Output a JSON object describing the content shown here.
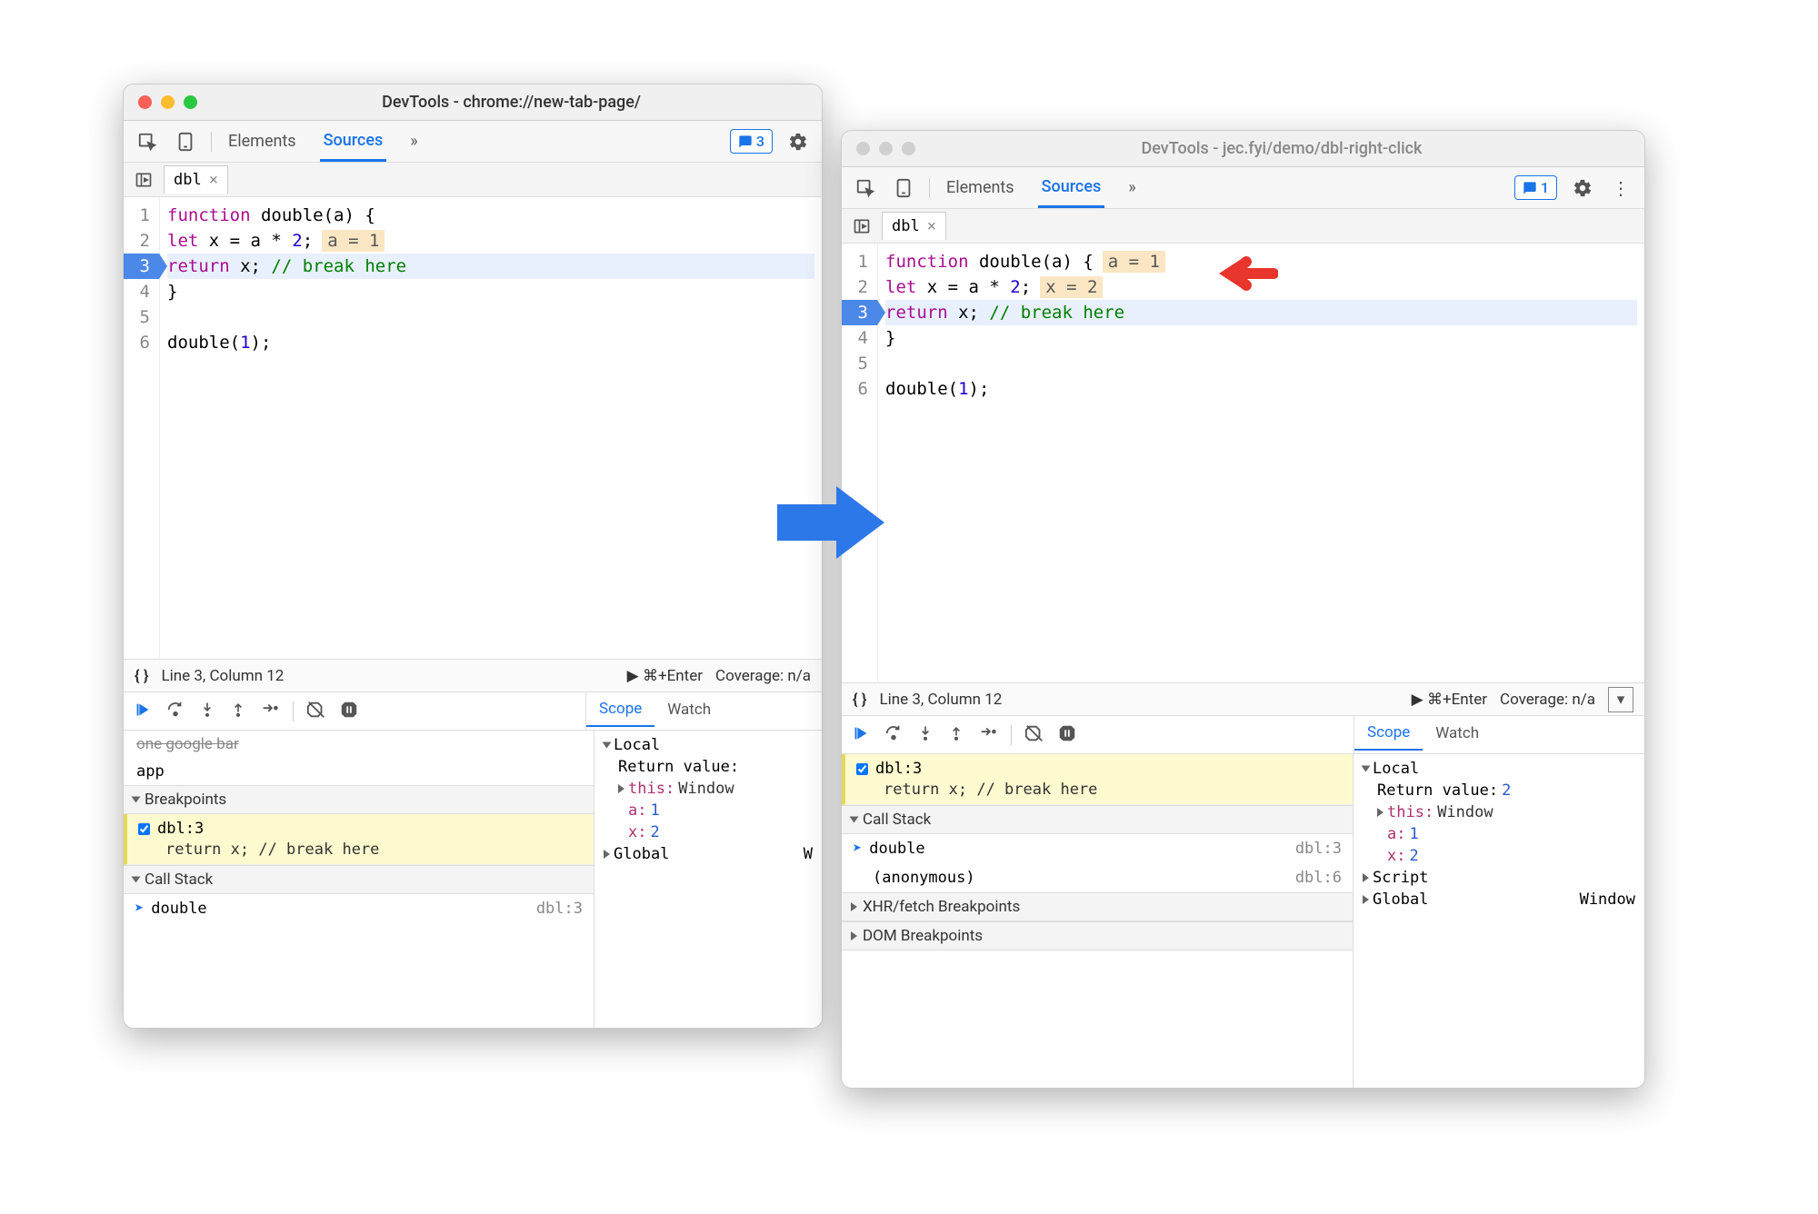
{
  "win1": {
    "title": "DevTools - chrome://new-tab-page/",
    "tabs": {
      "elements": "Elements",
      "sources": "Sources",
      "more": "»"
    },
    "badge": "3",
    "file_tab": "dbl",
    "code": {
      "lines": [
        {
          "n": 1,
          "segs": [
            [
              "k",
              "function"
            ],
            [
              "f",
              " double(a) {"
            ]
          ]
        },
        {
          "n": 2,
          "segs": [
            [
              "k",
              "  let"
            ],
            [
              "f",
              " x = a * "
            ],
            [
              "n2",
              "2"
            ],
            [
              "f",
              ";"
            ]
          ],
          "inline": "a = 1"
        },
        {
          "n": 3,
          "bp": true,
          "hl": true,
          "segs": [
            [
              "k",
              "  return"
            ],
            [
              "f",
              " x; "
            ],
            [
              "c",
              "// break here"
            ]
          ]
        },
        {
          "n": 4,
          "segs": [
            [
              "f",
              "}"
            ]
          ]
        },
        {
          "n": 5,
          "segs": [
            [
              "f",
              ""
            ]
          ]
        },
        {
          "n": 6,
          "segs": [
            [
              "f",
              "double("
            ],
            [
              "n2",
              "1"
            ],
            [
              "f",
              ");"
            ]
          ]
        }
      ]
    },
    "status": {
      "cursor": "Line 3, Column 12",
      "run": "⌘+Enter",
      "cov": "Coverage: n/a"
    },
    "left_panel": {
      "stray": [
        "app"
      ],
      "breakpoints_hdr": "Breakpoints",
      "bp_item": {
        "label": "dbl:3",
        "code": "return x; // break here"
      },
      "callstack_hdr": "Call Stack",
      "frames": [
        {
          "name": "double",
          "loc": "dbl:3"
        }
      ]
    },
    "scope": {
      "tab_scope": "Scope",
      "tab_watch": "Watch",
      "local": "Local",
      "ret": "Return value:",
      "this_label": "this:",
      "this_val": "Window",
      "a_label": "a:",
      "a_val": "1",
      "x_label": "x:",
      "x_val": "2",
      "global": "Global",
      "global_val": "W"
    }
  },
  "win2": {
    "title": "DevTools - jec.fyi/demo/dbl-right-click",
    "tabs": {
      "elements": "Elements",
      "sources": "Sources",
      "more": "»"
    },
    "badge": "1",
    "file_tab": "dbl",
    "code": {
      "lines": [
        {
          "n": 1,
          "segs": [
            [
              "k",
              "function"
            ],
            [
              "f",
              " double(a) {"
            ]
          ],
          "inline": "a = 1"
        },
        {
          "n": 2,
          "segs": [
            [
              "k",
              "  let"
            ],
            [
              "f",
              " x = a * "
            ],
            [
              "n2",
              "2"
            ],
            [
              "f",
              ";"
            ]
          ],
          "inline": "x = 2"
        },
        {
          "n": 3,
          "bp": true,
          "hl": true,
          "segs": [
            [
              "k",
              "  return"
            ],
            [
              "f",
              " x; "
            ],
            [
              "c",
              "// break here"
            ]
          ]
        },
        {
          "n": 4,
          "segs": [
            [
              "f",
              "}"
            ]
          ]
        },
        {
          "n": 5,
          "segs": [
            [
              "f",
              ""
            ]
          ]
        },
        {
          "n": 6,
          "segs": [
            [
              "f",
              "double("
            ],
            [
              "n2",
              "1"
            ],
            [
              "f",
              ");"
            ]
          ]
        }
      ]
    },
    "status": {
      "cursor": "Line 3, Column 12",
      "run": "⌘+Enter",
      "cov": "Coverage: n/a"
    },
    "left_panel": {
      "bp_item": {
        "label": "dbl:3",
        "code": "return x; // break here"
      },
      "callstack_hdr": "Call Stack",
      "frames": [
        {
          "name": "double",
          "loc": "dbl:3",
          "active": true
        },
        {
          "name": "(anonymous)",
          "loc": "dbl:6"
        }
      ],
      "xhr_hdr": "XHR/fetch Breakpoints",
      "dom_hdr": "DOM Breakpoints"
    },
    "scope": {
      "tab_scope": "Scope",
      "tab_watch": "Watch",
      "local": "Local",
      "ret": "Return value:",
      "ret_val": "2",
      "this_label": "this:",
      "this_val": "Window",
      "a_label": "a:",
      "a_val": "1",
      "x_label": "x:",
      "x_val": "2",
      "script": "Script",
      "global": "Global",
      "global_val": "Window"
    }
  }
}
